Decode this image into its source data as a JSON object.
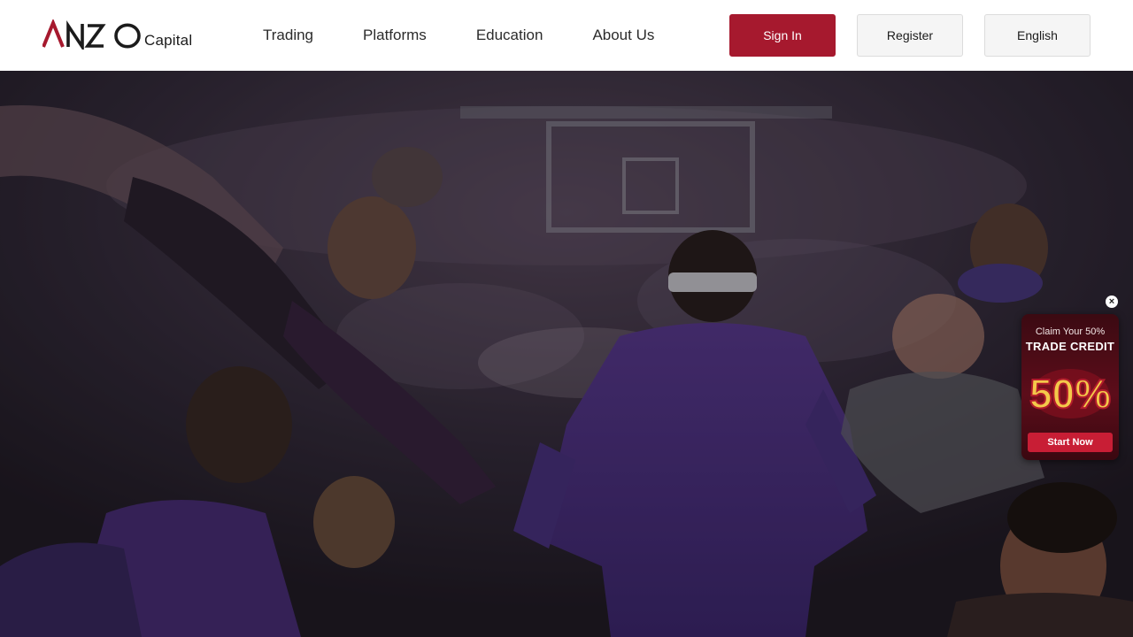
{
  "header": {
    "logo_text": "ANZO",
    "logo_sub": "Capital",
    "nav": [
      {
        "label": "Trading"
      },
      {
        "label": "Platforms"
      },
      {
        "label": "Education"
      },
      {
        "label": "About Us"
      }
    ],
    "signin_label": "Sign In",
    "register_label": "Register",
    "language_label": "English"
  },
  "hero": {
    "image_description_icon": "basketball-arena-photo"
  },
  "promo": {
    "close_symbol": "×",
    "line1": "Claim Your 50%",
    "line2": "TRADE CREDIT",
    "big_text": "50%",
    "button_label": "Start Now"
  },
  "colors": {
    "brand_red": "#a6192e",
    "promo_button": "#c81e35",
    "header_bg": "#ffffff"
  }
}
